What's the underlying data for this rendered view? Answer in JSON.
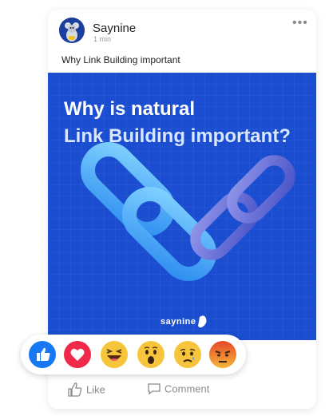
{
  "post": {
    "author": "Saynine",
    "time": "1 min",
    "caption": "Why Link Building important",
    "image": {
      "headline_line1": "Why is natural",
      "headline_line2": "Link Building important?",
      "brand": "saynine",
      "background_color": "#1a4dd0"
    }
  },
  "reactions": [
    {
      "name": "like",
      "icon": "thumbs-up-icon",
      "color": "#1877f2"
    },
    {
      "name": "love",
      "icon": "heart-icon",
      "color": "#f0284a"
    },
    {
      "name": "haha",
      "icon": "laughing-face-icon",
      "color": "#f7c53b"
    },
    {
      "name": "wow",
      "icon": "surprised-face-icon",
      "color": "#f7c53b"
    },
    {
      "name": "sad",
      "icon": "sad-face-icon",
      "color": "#f7c53b"
    },
    {
      "name": "angry",
      "icon": "angry-face-icon",
      "color": "#e9710f"
    }
  ],
  "actions": {
    "like_label": "Like",
    "comment_label": "Comment"
  }
}
